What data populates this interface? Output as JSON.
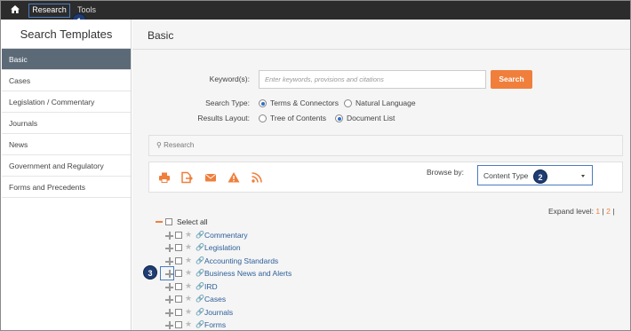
{
  "topbar": {
    "home_icon": "home-icon",
    "research": "Research",
    "tools": "Tools",
    "callouts": [
      "1",
      "2",
      "3"
    ]
  },
  "sidebar": {
    "title": "Search Templates",
    "items": [
      {
        "label": "Basic",
        "active": true
      },
      {
        "label": "Cases"
      },
      {
        "label": "Legislation / Commentary"
      },
      {
        "label": "Journals"
      },
      {
        "label": "News"
      },
      {
        "label": "Government and Regulatory"
      },
      {
        "label": "Forms and Precedents"
      }
    ]
  },
  "main": {
    "title": "Basic",
    "keyword_label": "Keyword(s):",
    "keyword_placeholder": "Enter keywords, provisions and citations",
    "search_button": "Search",
    "search_type_label": "Search Type:",
    "search_type_options": [
      "Terms & Connectors",
      "Natural Language"
    ],
    "search_type_selected": "Terms & Connectors",
    "results_layout_label": "Results Layout:",
    "results_layout_options": [
      "Tree of Contents",
      "Document List"
    ],
    "results_layout_selected": "Document List",
    "breadcrumb": "Research",
    "toolbar_icons": [
      "print-icon",
      "export-icon",
      "email-icon",
      "alert-icon",
      "rss-icon"
    ],
    "browse_by_label": "Browse by:",
    "browse_by_value": "Content Type",
    "expand_label": "Expand level:",
    "expand_levels": [
      "1",
      "|",
      "2",
      "|"
    ],
    "tree": [
      {
        "label": "Select all",
        "type": "select-all"
      },
      {
        "label": "Commentary"
      },
      {
        "label": "Legislation"
      },
      {
        "label": "Accounting Standards"
      },
      {
        "label": "Business News and Alerts"
      },
      {
        "label": "IRD"
      },
      {
        "label": "Cases"
      },
      {
        "label": "Journals"
      },
      {
        "label": "Forms"
      }
    ]
  },
  "colors": {
    "accent": "#f07f3c",
    "active_sidebar": "#5c6a78",
    "link": "#2d5f99",
    "callout": "#1f3d73",
    "highlight_border": "#4a7cc0"
  }
}
